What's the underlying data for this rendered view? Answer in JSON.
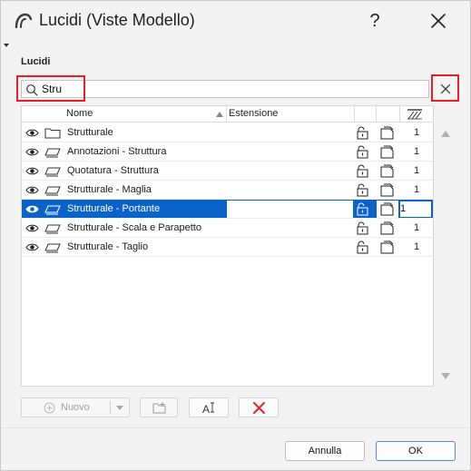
{
  "window": {
    "title": "Lucidi (Viste Modello)",
    "help_label": "?"
  },
  "section": {
    "label": "Lucidi"
  },
  "search": {
    "value": "Stru",
    "placeholder": ""
  },
  "list": {
    "columns": {
      "name": "Nome",
      "extension": "Estensione"
    },
    "rows": [
      {
        "name": "Strutturale",
        "type": "folder-icon",
        "count": "1",
        "selected": false
      },
      {
        "name": "Annotazioni - Struttura",
        "type": "layer-icon",
        "count": "1",
        "selected": false
      },
      {
        "name": "Quotatura - Struttura",
        "type": "layer-icon",
        "count": "1",
        "selected": false
      },
      {
        "name": "Strutturale - Maglia",
        "type": "layer-icon",
        "count": "1",
        "selected": false
      },
      {
        "name": "Strutturale - Portante",
        "type": "layer-icon",
        "count": "1",
        "selected": true
      },
      {
        "name": "Strutturale - Scala e Parapetto",
        "type": "layer-icon",
        "count": "1",
        "selected": false
      },
      {
        "name": "Strutturale - Taglio",
        "type": "layer-icon",
        "count": "1",
        "selected": false
      }
    ]
  },
  "toolbar": {
    "new_label": "Nuovo"
  },
  "footer": {
    "cancel_label": "Annulla",
    "ok_label": "OK"
  },
  "colors": {
    "accent": "#0a63c9",
    "highlight": "#e5202a",
    "delete": "#e0281e"
  }
}
